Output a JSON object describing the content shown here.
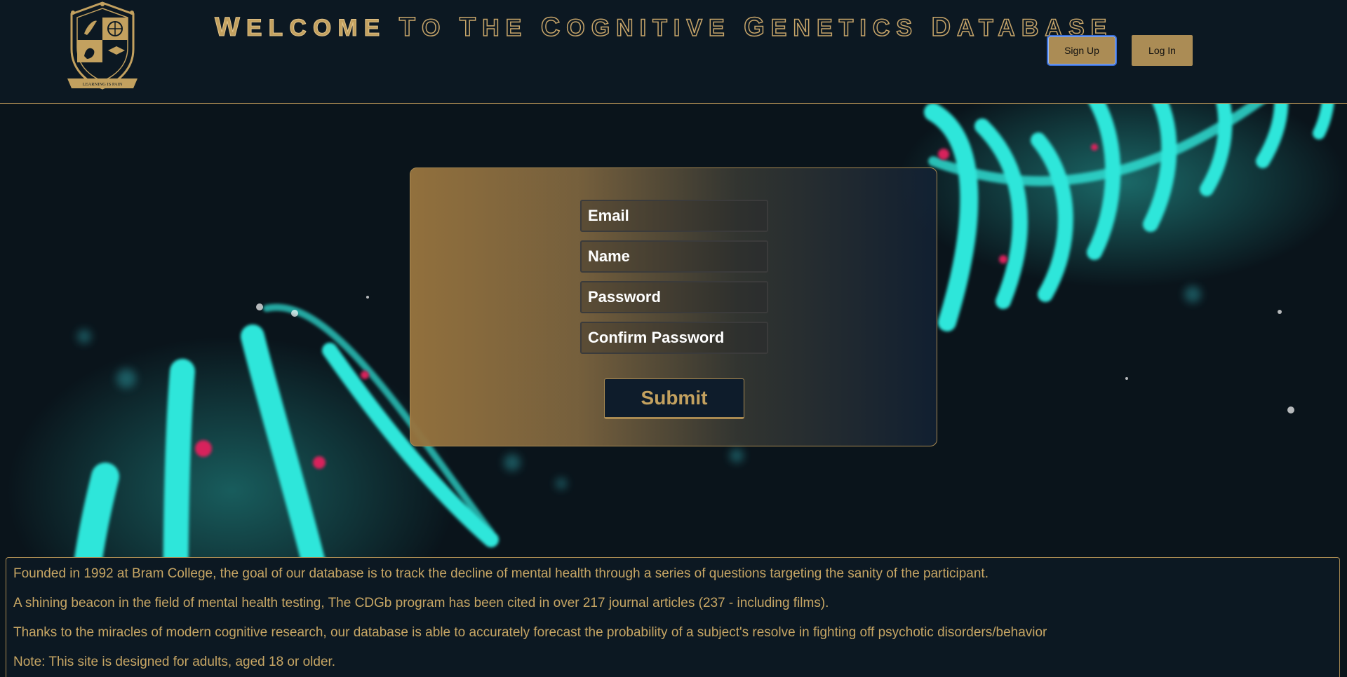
{
  "header": {
    "title": "WELCOME TO THE COGNITIVE GENETICS DATABASE",
    "logo_motto": "LEARNING IS PAIN",
    "signup_label": "Sign Up",
    "login_label": "Log In"
  },
  "signup_form": {
    "email_placeholder": "Email",
    "name_placeholder": "Name",
    "password_placeholder": "Password",
    "confirm_placeholder": "Confirm Password",
    "submit_label": "Submit"
  },
  "about": {
    "paragraphs": [
      "Founded in 1992 at Bram College, the goal of our database is to track the decline of mental health through a series of questions targeting the sanity of the participant.",
      "A shining beacon in the field of mental health testing, The CDGb program has been cited in over 217 journal articles (237 - including films).",
      "Thanks to the miracles of modern cognitive research, our database is able to accurately forecast the probability of a subject's resolve in fighting off psychotic disorders/behavior",
      "Note: This site is designed for adults, aged 18 or older."
    ]
  },
  "colors": {
    "gold": "#ab8c55",
    "navy": "#0c1822",
    "cyan": "#2ee6d9",
    "magenta": "#d8245c"
  }
}
